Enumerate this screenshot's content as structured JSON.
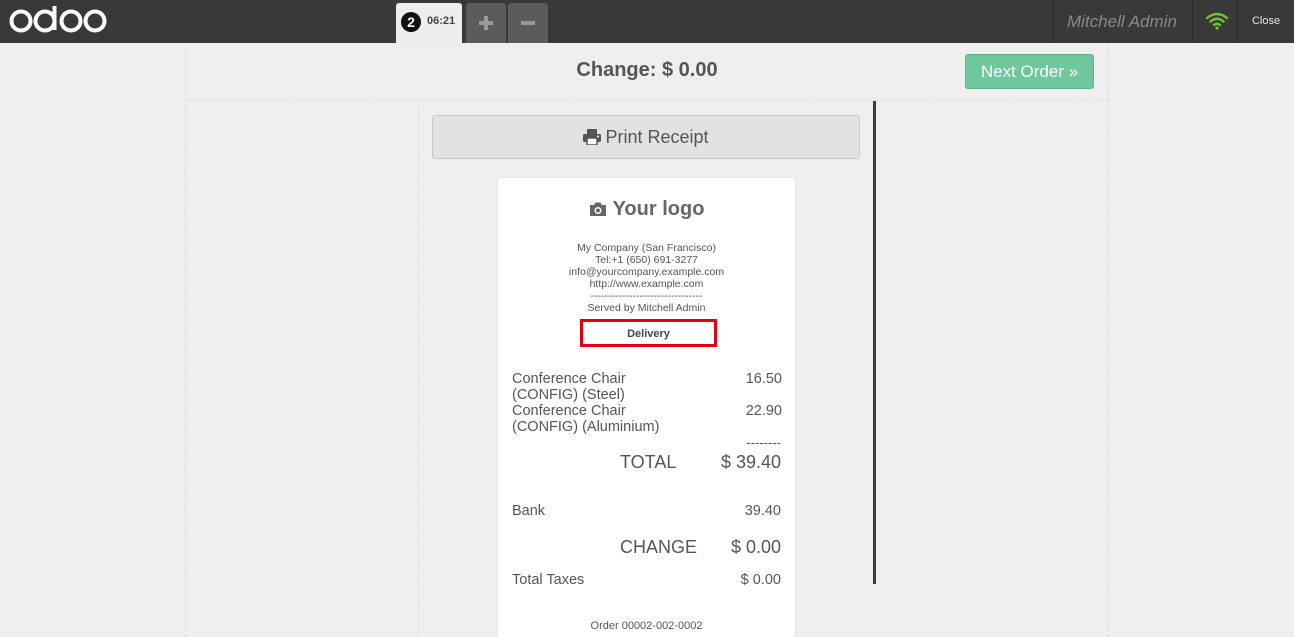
{
  "topbar": {
    "brand": "odoo",
    "order_tab": {
      "number": "2",
      "time": "06:21"
    },
    "add_order_icon": "plus-icon",
    "remove_order_icon": "minus-icon",
    "user_name": "Mitchell Admin",
    "connection_icon": "wifi-icon",
    "close_label": "Close"
  },
  "screen": {
    "change_title": "Change: $ 0.00",
    "next_order_label": "Next Order »",
    "print_receipt_label": "Print Receipt"
  },
  "receipt": {
    "logo_text": "Your logo",
    "company_lines": [
      "My Company (San Francisco)",
      "Tel:+1 (650) 691-3277",
      "info@yourcompany.example.com",
      "http://www.example.com",
      "--------------------------------",
      "Served by Mitchell Admin"
    ],
    "delivery_label": "Delivery",
    "lines": [
      {
        "name": "Conference Chair (CONFIG) (Steel)",
        "price": "16.50"
      },
      {
        "name": "Conference Chair (CONFIG) (Aluminium)",
        "price": "22.90"
      }
    ],
    "dashes": "--------",
    "total_label": "TOTAL",
    "total_value": "$ 39.40",
    "payment_name": "Bank",
    "payment_value": "39.40",
    "change_label": "CHANGE",
    "change_value": "$ 0.00",
    "taxes_label": "Total Taxes",
    "taxes_value": "$ 0.00",
    "order_ref": "Order 00002-002-0002"
  },
  "colors": {
    "topbar": "#393939",
    "next_order": "#6ec89b",
    "highlight_box": "#e3000f",
    "wifi": "#6ec82b"
  }
}
